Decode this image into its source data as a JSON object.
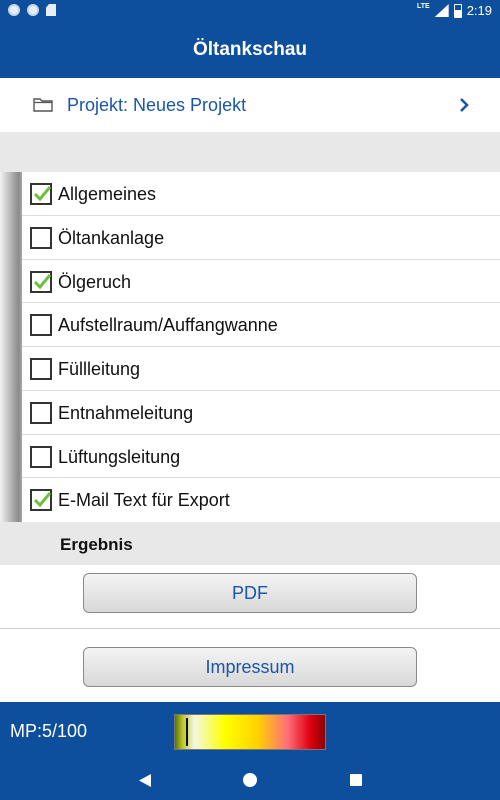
{
  "status_bar": {
    "network": "LTE",
    "time": "2:19"
  },
  "app_bar": {
    "title": "Öltankschau"
  },
  "project": {
    "label": "Projekt: Neues Projekt",
    "icon": "folder-icon"
  },
  "checklist": {
    "items": [
      {
        "label": "Allgemeines",
        "checked": true
      },
      {
        "label": "Öltankanlage",
        "checked": false
      },
      {
        "label": "Ölgeruch",
        "checked": true
      },
      {
        "label": "Aufstellraum/Auffangwanne",
        "checked": false
      },
      {
        "label": "Füllleitung",
        "checked": false
      },
      {
        "label": "Entnahmeleitung",
        "checked": false
      },
      {
        "label": "Lüftungsleitung",
        "checked": false
      },
      {
        "label": "E-Mail Text für Export",
        "checked": true
      }
    ]
  },
  "result": {
    "header": "Ergebnis",
    "pdf_button": "PDF",
    "impressum_button": "Impressum"
  },
  "mp": {
    "label": "MP:5/100",
    "value": 5,
    "max": 100
  },
  "colors": {
    "primary": "#0d4f9c",
    "link": "#1a55a8",
    "check": "#6cc03a"
  }
}
